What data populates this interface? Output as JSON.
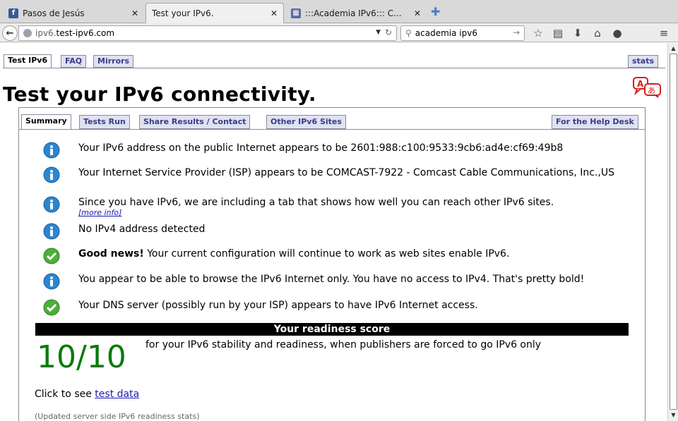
{
  "browser": {
    "tabs": [
      {
        "title": "Pasos de Jesús",
        "favicon": "facebook-icon",
        "active": false
      },
      {
        "title": "Test your IPv6.",
        "favicon": "none",
        "active": true
      },
      {
        "title": ":::Academia IPv6::: C...",
        "favicon": "site-icon",
        "active": false
      }
    ],
    "url_host": "ipv6.",
    "url_domain": "test-ipv6.com",
    "search_value": "academia ipv6"
  },
  "page": {
    "top_tabs": [
      "Test IPv6",
      "FAQ",
      "Mirrors"
    ],
    "stats_tab": "stats",
    "title": "Test your IPv6 connectivity.",
    "sub_tabs": [
      "Summary",
      "Tests Run",
      "Share Results / Contact",
      "Other IPv6 Sites"
    ],
    "help_desk_tab": "For the Help Desk",
    "rows": [
      {
        "icon": "info-icon",
        "text": "Your IPv6 address on the public Internet appears to be 2601:988:c100:9533:9cb6:ad4e:cf69:49b8"
      },
      {
        "icon": "info-icon",
        "text": "Your Internet Service Provider (ISP) appears to be COMCAST-7922 - Comcast Cable Communications, Inc.,US"
      },
      {
        "icon": "info-icon",
        "text": "Since you have IPv6, we are including a tab that shows how well you can reach other IPv6 sites.",
        "more": "[more info]"
      },
      {
        "icon": "info-icon",
        "text": "No IPv4 address detected"
      },
      {
        "icon": "check-icon",
        "bold": "Good news!",
        "text": " Your current configuration will continue to work as web sites enable IPv6."
      },
      {
        "icon": "info-icon",
        "text": "You appear to be able to browse the IPv6 Internet only. You have no access to IPv4. That's pretty bold!"
      },
      {
        "icon": "check-icon",
        "text": "Your DNS server (possibly run by your ISP) appears to have IPv6 Internet access."
      }
    ],
    "readiness_header": "Your readiness score",
    "score": "10/10",
    "score_desc": "for your IPv6 stability and readiness, when publishers are forced to go IPv6 only",
    "click_prefix": "Click to see ",
    "click_link": "test data",
    "updated": "(Updated server side IPv6 readiness stats)"
  },
  "colors": {
    "score": "#0a7a0a",
    "link": "#1a1ab0",
    "tab_bg": "#dfe2f0"
  }
}
